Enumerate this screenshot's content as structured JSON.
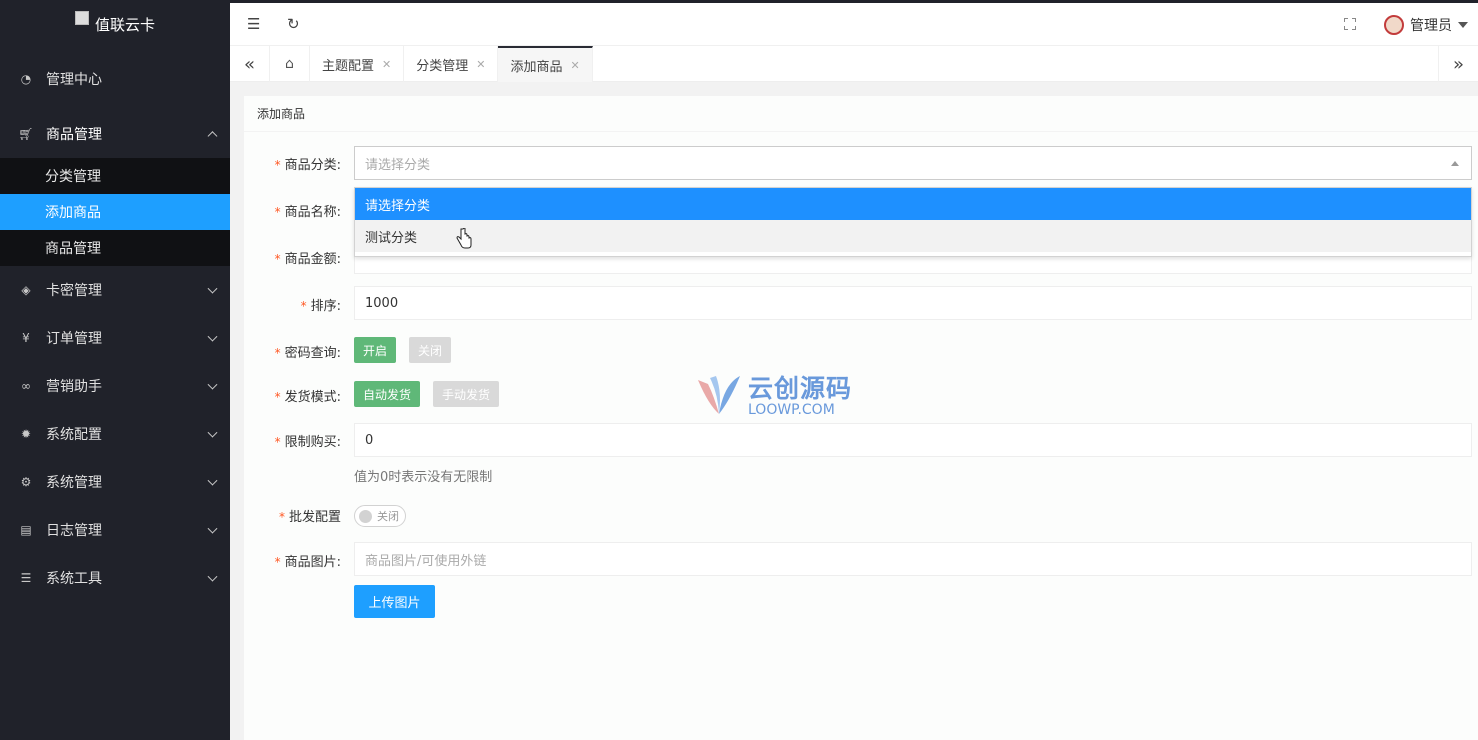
{
  "app": {
    "logo_text": "值联云卡"
  },
  "sidebar": {
    "items": [
      {
        "label": "管理中心",
        "icon": "dashboard-icon"
      },
      {
        "label": "商品管理",
        "icon": "cart-icon",
        "open": true,
        "children": [
          {
            "label": "分类管理"
          },
          {
            "label": "添加商品",
            "active": true
          },
          {
            "label": "商品管理"
          }
        ]
      },
      {
        "label": "卡密管理",
        "icon": "layers-icon"
      },
      {
        "label": "订单管理",
        "icon": "yen-icon"
      },
      {
        "label": "营销助手",
        "icon": "link-icon"
      },
      {
        "label": "系统配置",
        "icon": "gear-icon"
      },
      {
        "label": "系统管理",
        "icon": "settings-icon"
      },
      {
        "label": "日志管理",
        "icon": "file-icon"
      },
      {
        "label": "系统工具",
        "icon": "sliders-icon"
      }
    ]
  },
  "header": {
    "user": "管理员"
  },
  "tabs": {
    "items": [
      {
        "label": "主题配置"
      },
      {
        "label": "分类管理"
      },
      {
        "label": "添加商品",
        "active": true
      }
    ]
  },
  "card": {
    "title": "添加商品"
  },
  "form": {
    "category": {
      "label": "商品分类:",
      "placeholder": "请选择分类",
      "options": [
        {
          "label": "请选择分类",
          "selected": true
        },
        {
          "label": "测试分类"
        }
      ]
    },
    "name": {
      "label": "商品名称:"
    },
    "price": {
      "label": "商品金额:"
    },
    "sort": {
      "label": "排序:",
      "value": "1000"
    },
    "password_query": {
      "label": "密码查询:",
      "on": "开启",
      "off": "关闭"
    },
    "delivery": {
      "label": "发货模式:",
      "auto": "自动发货",
      "manual": "手动发货"
    },
    "limit": {
      "label": "限制购买:",
      "value": "0",
      "hint": "值为0时表示没有无限制"
    },
    "wholesale": {
      "label": "批发配置",
      "switch_label": "关闭"
    },
    "image": {
      "label": "商品图片:",
      "placeholder": "商品图片/可使用外链",
      "upload": "上传图片"
    }
  },
  "watermark": {
    "cn": "云创源码",
    "en": "LOOWP.COM"
  },
  "colors": {
    "sidebar_bg": "#20222a",
    "active_blue": "#1e9fff",
    "green": "#5fb878"
  }
}
